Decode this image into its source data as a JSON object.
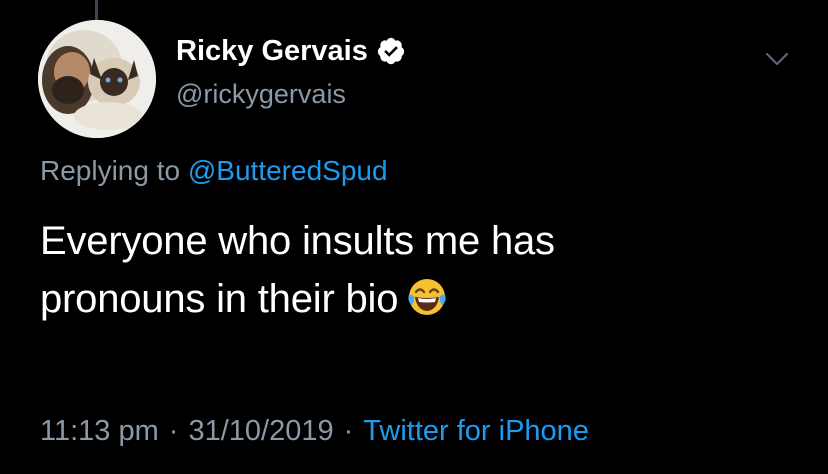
{
  "tweet": {
    "author": {
      "display_name": "Ricky Gervais",
      "handle": "@rickygervais",
      "verified": true,
      "avatar": "avatar-photo"
    },
    "reply": {
      "prefix": "Replying to",
      "handle": "@ButteredSpud"
    },
    "text_line1": "Everyone who insults me has",
    "text_line2": "pronouns in their bio",
    "emoji": "face-with-tears-of-joy-emoji",
    "time": "11:13 pm",
    "separator": "·",
    "date": "31/10/2019",
    "source": "Twitter for iPhone",
    "menu_icon": "chevron-down-icon"
  },
  "colors": {
    "background": "#000000",
    "primary_text": "#ffffff",
    "secondary_text": "#8b98a5",
    "link": "#1d9bf0",
    "verified_badge": "#ffffff"
  }
}
